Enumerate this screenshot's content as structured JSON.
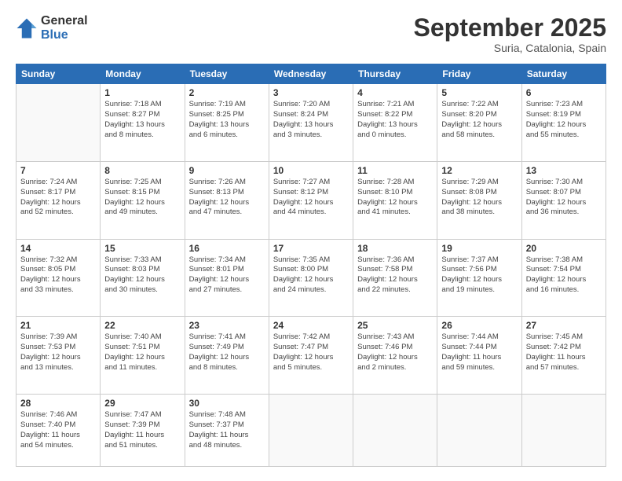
{
  "logo": {
    "general": "General",
    "blue": "Blue"
  },
  "title": "September 2025",
  "subtitle": "Suria, Catalonia, Spain",
  "days_header": [
    "Sunday",
    "Monday",
    "Tuesday",
    "Wednesday",
    "Thursday",
    "Friday",
    "Saturday"
  ],
  "weeks": [
    [
      {
        "day": "",
        "info": ""
      },
      {
        "day": "1",
        "info": "Sunrise: 7:18 AM\nSunset: 8:27 PM\nDaylight: 13 hours\nand 8 minutes."
      },
      {
        "day": "2",
        "info": "Sunrise: 7:19 AM\nSunset: 8:25 PM\nDaylight: 13 hours\nand 6 minutes."
      },
      {
        "day": "3",
        "info": "Sunrise: 7:20 AM\nSunset: 8:24 PM\nDaylight: 13 hours\nand 3 minutes."
      },
      {
        "day": "4",
        "info": "Sunrise: 7:21 AM\nSunset: 8:22 PM\nDaylight: 13 hours\nand 0 minutes."
      },
      {
        "day": "5",
        "info": "Sunrise: 7:22 AM\nSunset: 8:20 PM\nDaylight: 12 hours\nand 58 minutes."
      },
      {
        "day": "6",
        "info": "Sunrise: 7:23 AM\nSunset: 8:19 PM\nDaylight: 12 hours\nand 55 minutes."
      }
    ],
    [
      {
        "day": "7",
        "info": "Sunrise: 7:24 AM\nSunset: 8:17 PM\nDaylight: 12 hours\nand 52 minutes."
      },
      {
        "day": "8",
        "info": "Sunrise: 7:25 AM\nSunset: 8:15 PM\nDaylight: 12 hours\nand 49 minutes."
      },
      {
        "day": "9",
        "info": "Sunrise: 7:26 AM\nSunset: 8:13 PM\nDaylight: 12 hours\nand 47 minutes."
      },
      {
        "day": "10",
        "info": "Sunrise: 7:27 AM\nSunset: 8:12 PM\nDaylight: 12 hours\nand 44 minutes."
      },
      {
        "day": "11",
        "info": "Sunrise: 7:28 AM\nSunset: 8:10 PM\nDaylight: 12 hours\nand 41 minutes."
      },
      {
        "day": "12",
        "info": "Sunrise: 7:29 AM\nSunset: 8:08 PM\nDaylight: 12 hours\nand 38 minutes."
      },
      {
        "day": "13",
        "info": "Sunrise: 7:30 AM\nSunset: 8:07 PM\nDaylight: 12 hours\nand 36 minutes."
      }
    ],
    [
      {
        "day": "14",
        "info": "Sunrise: 7:32 AM\nSunset: 8:05 PM\nDaylight: 12 hours\nand 33 minutes."
      },
      {
        "day": "15",
        "info": "Sunrise: 7:33 AM\nSunset: 8:03 PM\nDaylight: 12 hours\nand 30 minutes."
      },
      {
        "day": "16",
        "info": "Sunrise: 7:34 AM\nSunset: 8:01 PM\nDaylight: 12 hours\nand 27 minutes."
      },
      {
        "day": "17",
        "info": "Sunrise: 7:35 AM\nSunset: 8:00 PM\nDaylight: 12 hours\nand 24 minutes."
      },
      {
        "day": "18",
        "info": "Sunrise: 7:36 AM\nSunset: 7:58 PM\nDaylight: 12 hours\nand 22 minutes."
      },
      {
        "day": "19",
        "info": "Sunrise: 7:37 AM\nSunset: 7:56 PM\nDaylight: 12 hours\nand 19 minutes."
      },
      {
        "day": "20",
        "info": "Sunrise: 7:38 AM\nSunset: 7:54 PM\nDaylight: 12 hours\nand 16 minutes."
      }
    ],
    [
      {
        "day": "21",
        "info": "Sunrise: 7:39 AM\nSunset: 7:53 PM\nDaylight: 12 hours\nand 13 minutes."
      },
      {
        "day": "22",
        "info": "Sunrise: 7:40 AM\nSunset: 7:51 PM\nDaylight: 12 hours\nand 11 minutes."
      },
      {
        "day": "23",
        "info": "Sunrise: 7:41 AM\nSunset: 7:49 PM\nDaylight: 12 hours\nand 8 minutes."
      },
      {
        "day": "24",
        "info": "Sunrise: 7:42 AM\nSunset: 7:47 PM\nDaylight: 12 hours\nand 5 minutes."
      },
      {
        "day": "25",
        "info": "Sunrise: 7:43 AM\nSunset: 7:46 PM\nDaylight: 12 hours\nand 2 minutes."
      },
      {
        "day": "26",
        "info": "Sunrise: 7:44 AM\nSunset: 7:44 PM\nDaylight: 11 hours\nand 59 minutes."
      },
      {
        "day": "27",
        "info": "Sunrise: 7:45 AM\nSunset: 7:42 PM\nDaylight: 11 hours\nand 57 minutes."
      }
    ],
    [
      {
        "day": "28",
        "info": "Sunrise: 7:46 AM\nSunset: 7:40 PM\nDaylight: 11 hours\nand 54 minutes."
      },
      {
        "day": "29",
        "info": "Sunrise: 7:47 AM\nSunset: 7:39 PM\nDaylight: 11 hours\nand 51 minutes."
      },
      {
        "day": "30",
        "info": "Sunrise: 7:48 AM\nSunset: 7:37 PM\nDaylight: 11 hours\nand 48 minutes."
      },
      {
        "day": "",
        "info": ""
      },
      {
        "day": "",
        "info": ""
      },
      {
        "day": "",
        "info": ""
      },
      {
        "day": "",
        "info": ""
      }
    ]
  ]
}
